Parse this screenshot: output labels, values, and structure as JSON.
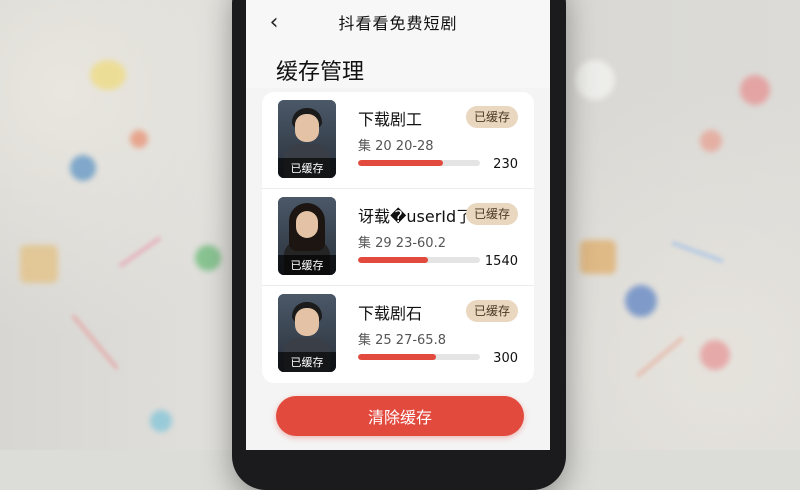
{
  "header": {
    "back_icon": "chevron-left-icon",
    "app_title": "抖看看免费短剧"
  },
  "page": {
    "title": "缓存管理"
  },
  "items": [
    {
      "title": "下载剧工",
      "thumb_label": "已缓存",
      "badge": "已缓存",
      "episodes": "集 20 20-28",
      "progress": 0.7,
      "size": "230",
      "portrait": "male"
    },
    {
      "title": "讶载�userId了",
      "thumb_label": "已缓存",
      "badge": "已缓存",
      "episodes": "集 29 23-60.2",
      "progress": 0.57,
      "size": "1540",
      "portrait": "female"
    },
    {
      "title": "下载剧石",
      "thumb_label": "已缓存",
      "badge": "已缓存",
      "episodes": "集 25 27-65.8",
      "progress": 0.64,
      "size": "300",
      "portrait": "male"
    }
  ],
  "footer": {
    "clear_label": "清除缓存"
  },
  "colors": {
    "accent": "#e24a3e",
    "badge_bg": "#ead7bf",
    "progress_track": "#e4e4e4"
  }
}
